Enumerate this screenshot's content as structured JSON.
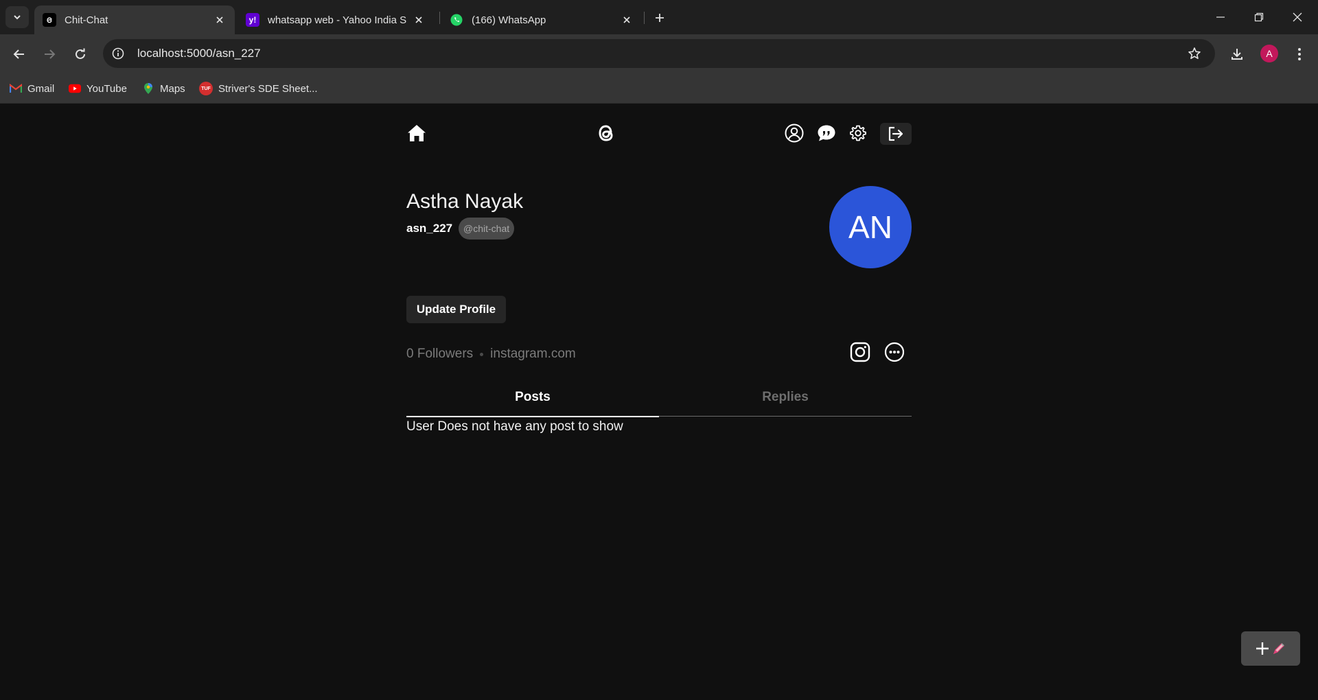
{
  "browser": {
    "tabs": [
      {
        "title": "Chit-Chat",
        "active": true,
        "favicon": "threads-icon"
      },
      {
        "title": "whatsapp web - Yahoo India Se",
        "active": false,
        "favicon": "yahoo-icon"
      },
      {
        "title": "(166) WhatsApp",
        "active": false,
        "favicon": "whatsapp-icon"
      }
    ],
    "url": "localhost:5000/asn_227",
    "profile_initial": "A",
    "bookmarks": [
      {
        "label": "Gmail",
        "icon": "gmail-icon"
      },
      {
        "label": "YouTube",
        "icon": "youtube-icon"
      },
      {
        "label": "Maps",
        "icon": "maps-icon"
      },
      {
        "label": "Striver's SDE Sheet...",
        "icon": "tuf-icon"
      }
    ],
    "colors": {
      "tabstrip": "#1f1f1f",
      "toolbar": "#353535",
      "omnibox": "#222222",
      "profile": "#c2185b"
    }
  },
  "app": {
    "nav": {
      "icons": [
        "home-icon",
        "app-logo-icon",
        "profile-icon",
        "chat-icon",
        "settings-icon",
        "logout-icon"
      ]
    },
    "profile": {
      "name": "Astha Nayak",
      "username": "asn_227",
      "domain_badge": "@chit-chat",
      "avatar_initials": "AN",
      "avatar_color": "#2b55d9",
      "update_button": "Update Profile",
      "followers": "0 Followers",
      "link": "instagram.com"
    },
    "tabs": [
      {
        "label": "Posts",
        "active": true
      },
      {
        "label": "Replies",
        "active": false
      }
    ],
    "empty_message": "User Does not have any post to show",
    "fab": {
      "icons": [
        "plus-icon",
        "pen-icon"
      ]
    }
  }
}
